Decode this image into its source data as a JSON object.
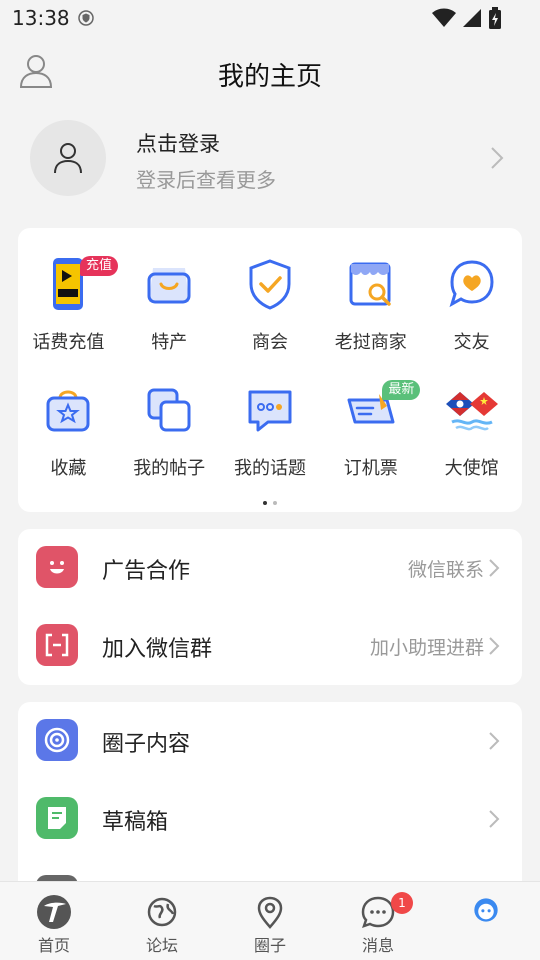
{
  "status": {
    "time": "13:38"
  },
  "header": {
    "title": "我的主页"
  },
  "login": {
    "name": "点击登录",
    "subtitle": "登录后查看更多"
  },
  "grid": {
    "items": [
      {
        "label": "话费充值",
        "icon": "phone-topup-icon",
        "badge": "充值",
        "badge_color": "#e6335a"
      },
      {
        "label": "特产",
        "icon": "shopping-bag-icon"
      },
      {
        "label": "商会",
        "icon": "shield-check-icon"
      },
      {
        "label": "老挝商家",
        "icon": "store-search-icon"
      },
      {
        "label": "交友",
        "icon": "heart-chat-icon"
      },
      {
        "label": "收藏",
        "icon": "star-bag-icon"
      },
      {
        "label": "我的帖子",
        "icon": "copy-posts-icon"
      },
      {
        "label": "我的话题",
        "icon": "chat-bubble-icon"
      },
      {
        "label": "订机票",
        "icon": "plane-ticket-icon",
        "badge": "最新",
        "badge_color": "#5ac07a"
      },
      {
        "label": "大使馆",
        "icon": "laos-china-flags-icon"
      }
    ]
  },
  "list1": {
    "rows": [
      {
        "title": "广告合作",
        "hint": "微信联系",
        "icon": "smile-icon",
        "color": "#e05468"
      },
      {
        "title": "加入微信群",
        "hint": "加小助理进群",
        "icon": "scan-bracket-icon",
        "color": "#e05468"
      }
    ]
  },
  "list2": {
    "rows": [
      {
        "title": "圈子内容",
        "hint": "",
        "icon": "circle-swirl-icon",
        "color": "#5b77e8"
      },
      {
        "title": "草稿箱",
        "hint": "",
        "icon": "draft-note-icon",
        "color": "#4fba6a"
      }
    ]
  },
  "tabbar": {
    "tabs": [
      {
        "label": "首页",
        "icon": "home-logo-icon"
      },
      {
        "label": "论坛",
        "icon": "globe-icon"
      },
      {
        "label": "圈子",
        "icon": "location-pin-icon"
      },
      {
        "label": "消息",
        "icon": "message-icon",
        "badge": "1"
      },
      {
        "label": "",
        "icon": "profile-face-icon"
      }
    ]
  }
}
